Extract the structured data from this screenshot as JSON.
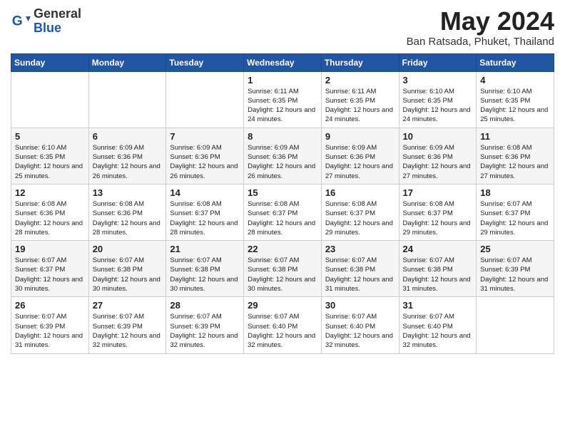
{
  "header": {
    "logo_general": "General",
    "logo_blue": "Blue",
    "month_title": "May 2024",
    "location": "Ban Ratsada, Phuket, Thailand"
  },
  "weekdays": [
    "Sunday",
    "Monday",
    "Tuesday",
    "Wednesday",
    "Thursday",
    "Friday",
    "Saturday"
  ],
  "weeks": [
    [
      {
        "day": "",
        "info": ""
      },
      {
        "day": "",
        "info": ""
      },
      {
        "day": "",
        "info": ""
      },
      {
        "day": "1",
        "info": "Sunrise: 6:11 AM\nSunset: 6:35 PM\nDaylight: 12 hours and 24 minutes."
      },
      {
        "day": "2",
        "info": "Sunrise: 6:11 AM\nSunset: 6:35 PM\nDaylight: 12 hours and 24 minutes."
      },
      {
        "day": "3",
        "info": "Sunrise: 6:10 AM\nSunset: 6:35 PM\nDaylight: 12 hours and 24 minutes."
      },
      {
        "day": "4",
        "info": "Sunrise: 6:10 AM\nSunset: 6:35 PM\nDaylight: 12 hours and 25 minutes."
      }
    ],
    [
      {
        "day": "5",
        "info": "Sunrise: 6:10 AM\nSunset: 6:35 PM\nDaylight: 12 hours and 25 minutes."
      },
      {
        "day": "6",
        "info": "Sunrise: 6:09 AM\nSunset: 6:36 PM\nDaylight: 12 hours and 26 minutes."
      },
      {
        "day": "7",
        "info": "Sunrise: 6:09 AM\nSunset: 6:36 PM\nDaylight: 12 hours and 26 minutes."
      },
      {
        "day": "8",
        "info": "Sunrise: 6:09 AM\nSunset: 6:36 PM\nDaylight: 12 hours and 26 minutes."
      },
      {
        "day": "9",
        "info": "Sunrise: 6:09 AM\nSunset: 6:36 PM\nDaylight: 12 hours and 27 minutes."
      },
      {
        "day": "10",
        "info": "Sunrise: 6:09 AM\nSunset: 6:36 PM\nDaylight: 12 hours and 27 minutes."
      },
      {
        "day": "11",
        "info": "Sunrise: 6:08 AM\nSunset: 6:36 PM\nDaylight: 12 hours and 27 minutes."
      }
    ],
    [
      {
        "day": "12",
        "info": "Sunrise: 6:08 AM\nSunset: 6:36 PM\nDaylight: 12 hours and 28 minutes."
      },
      {
        "day": "13",
        "info": "Sunrise: 6:08 AM\nSunset: 6:36 PM\nDaylight: 12 hours and 28 minutes."
      },
      {
        "day": "14",
        "info": "Sunrise: 6:08 AM\nSunset: 6:37 PM\nDaylight: 12 hours and 28 minutes."
      },
      {
        "day": "15",
        "info": "Sunrise: 6:08 AM\nSunset: 6:37 PM\nDaylight: 12 hours and 28 minutes."
      },
      {
        "day": "16",
        "info": "Sunrise: 6:08 AM\nSunset: 6:37 PM\nDaylight: 12 hours and 29 minutes."
      },
      {
        "day": "17",
        "info": "Sunrise: 6:08 AM\nSunset: 6:37 PM\nDaylight: 12 hours and 29 minutes."
      },
      {
        "day": "18",
        "info": "Sunrise: 6:07 AM\nSunset: 6:37 PM\nDaylight: 12 hours and 29 minutes."
      }
    ],
    [
      {
        "day": "19",
        "info": "Sunrise: 6:07 AM\nSunset: 6:37 PM\nDaylight: 12 hours and 30 minutes."
      },
      {
        "day": "20",
        "info": "Sunrise: 6:07 AM\nSunset: 6:38 PM\nDaylight: 12 hours and 30 minutes."
      },
      {
        "day": "21",
        "info": "Sunrise: 6:07 AM\nSunset: 6:38 PM\nDaylight: 12 hours and 30 minutes."
      },
      {
        "day": "22",
        "info": "Sunrise: 6:07 AM\nSunset: 6:38 PM\nDaylight: 12 hours and 30 minutes."
      },
      {
        "day": "23",
        "info": "Sunrise: 6:07 AM\nSunset: 6:38 PM\nDaylight: 12 hours and 31 minutes."
      },
      {
        "day": "24",
        "info": "Sunrise: 6:07 AM\nSunset: 6:38 PM\nDaylight: 12 hours and 31 minutes."
      },
      {
        "day": "25",
        "info": "Sunrise: 6:07 AM\nSunset: 6:39 PM\nDaylight: 12 hours and 31 minutes."
      }
    ],
    [
      {
        "day": "26",
        "info": "Sunrise: 6:07 AM\nSunset: 6:39 PM\nDaylight: 12 hours and 31 minutes."
      },
      {
        "day": "27",
        "info": "Sunrise: 6:07 AM\nSunset: 6:39 PM\nDaylight: 12 hours and 32 minutes."
      },
      {
        "day": "28",
        "info": "Sunrise: 6:07 AM\nSunset: 6:39 PM\nDaylight: 12 hours and 32 minutes."
      },
      {
        "day": "29",
        "info": "Sunrise: 6:07 AM\nSunset: 6:40 PM\nDaylight: 12 hours and 32 minutes."
      },
      {
        "day": "30",
        "info": "Sunrise: 6:07 AM\nSunset: 6:40 PM\nDaylight: 12 hours and 32 minutes."
      },
      {
        "day": "31",
        "info": "Sunrise: 6:07 AM\nSunset: 6:40 PM\nDaylight: 12 hours and 32 minutes."
      },
      {
        "day": "",
        "info": ""
      }
    ]
  ]
}
